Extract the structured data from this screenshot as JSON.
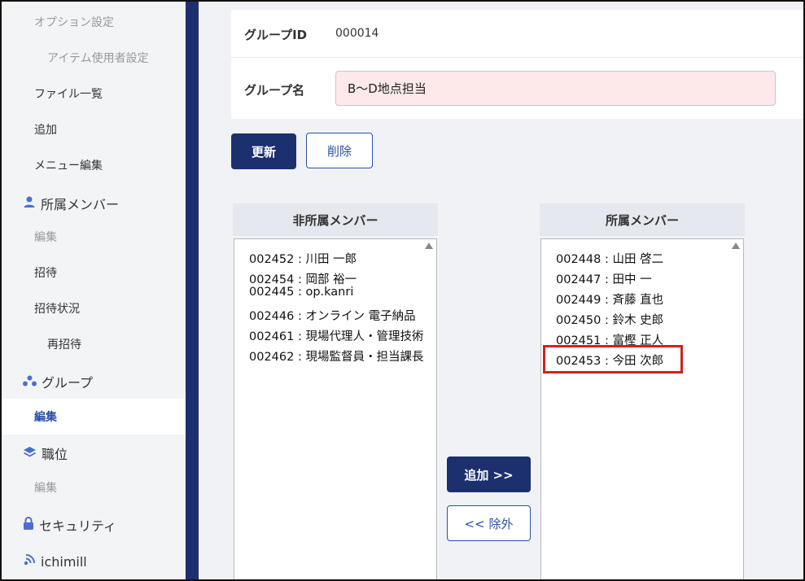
{
  "sidebar": {
    "items": [
      {
        "label": "オプション設定"
      },
      {
        "label": "アイテム使用者設定"
      },
      {
        "label": "ファイル一覧"
      },
      {
        "label": "追加"
      },
      {
        "label": "メニュー編集"
      },
      {
        "label": "所属メンバー",
        "icon": "person-icon"
      },
      {
        "label": "編集"
      },
      {
        "label": "招待"
      },
      {
        "label": "招待状況"
      },
      {
        "label": "再招待"
      },
      {
        "label": "グループ",
        "icon": "group-icon"
      },
      {
        "label": "編集",
        "active": true
      },
      {
        "label": "職位",
        "icon": "layers-icon"
      },
      {
        "label": "編集"
      },
      {
        "label": "セキュリティ",
        "icon": "lock-icon"
      },
      {
        "label": "ichimill",
        "icon": "signal-icon"
      }
    ]
  },
  "form": {
    "group_id_label": "グループID",
    "group_id_value": "000014",
    "group_name_label": "グループ名",
    "group_name_value": "B〜D地点担当"
  },
  "actions": {
    "update_label": "更新",
    "delete_label": "削除",
    "add_label": "追加 >>",
    "remove_label": "<< 除外"
  },
  "non_members": {
    "title": "非所属メンバー",
    "items": [
      "002452 : 川田 一郎",
      "002454 : 岡部 裕一",
      "002445 : op.kanri",
      "002446 : オンライン 電子納品",
      "002461 : 現場代理人・管理技術",
      "002462 : 現場監督員・担当課長"
    ]
  },
  "members": {
    "title": "所属メンバー",
    "items": [
      "002448 : 山田 啓二",
      "002447 : 田中 一",
      "002449 : 斉藤 直也",
      "002450 : 鈴木 史郎",
      "002451 : 富樫 正人",
      "002453 : 今田 次郎"
    ],
    "highlighted_index": 5,
    "highlight_color": "#d42020"
  },
  "colors": {
    "primary": "#1c2f6e",
    "link": "#2a4fa8",
    "name_input_bg": "#fde9ea"
  }
}
